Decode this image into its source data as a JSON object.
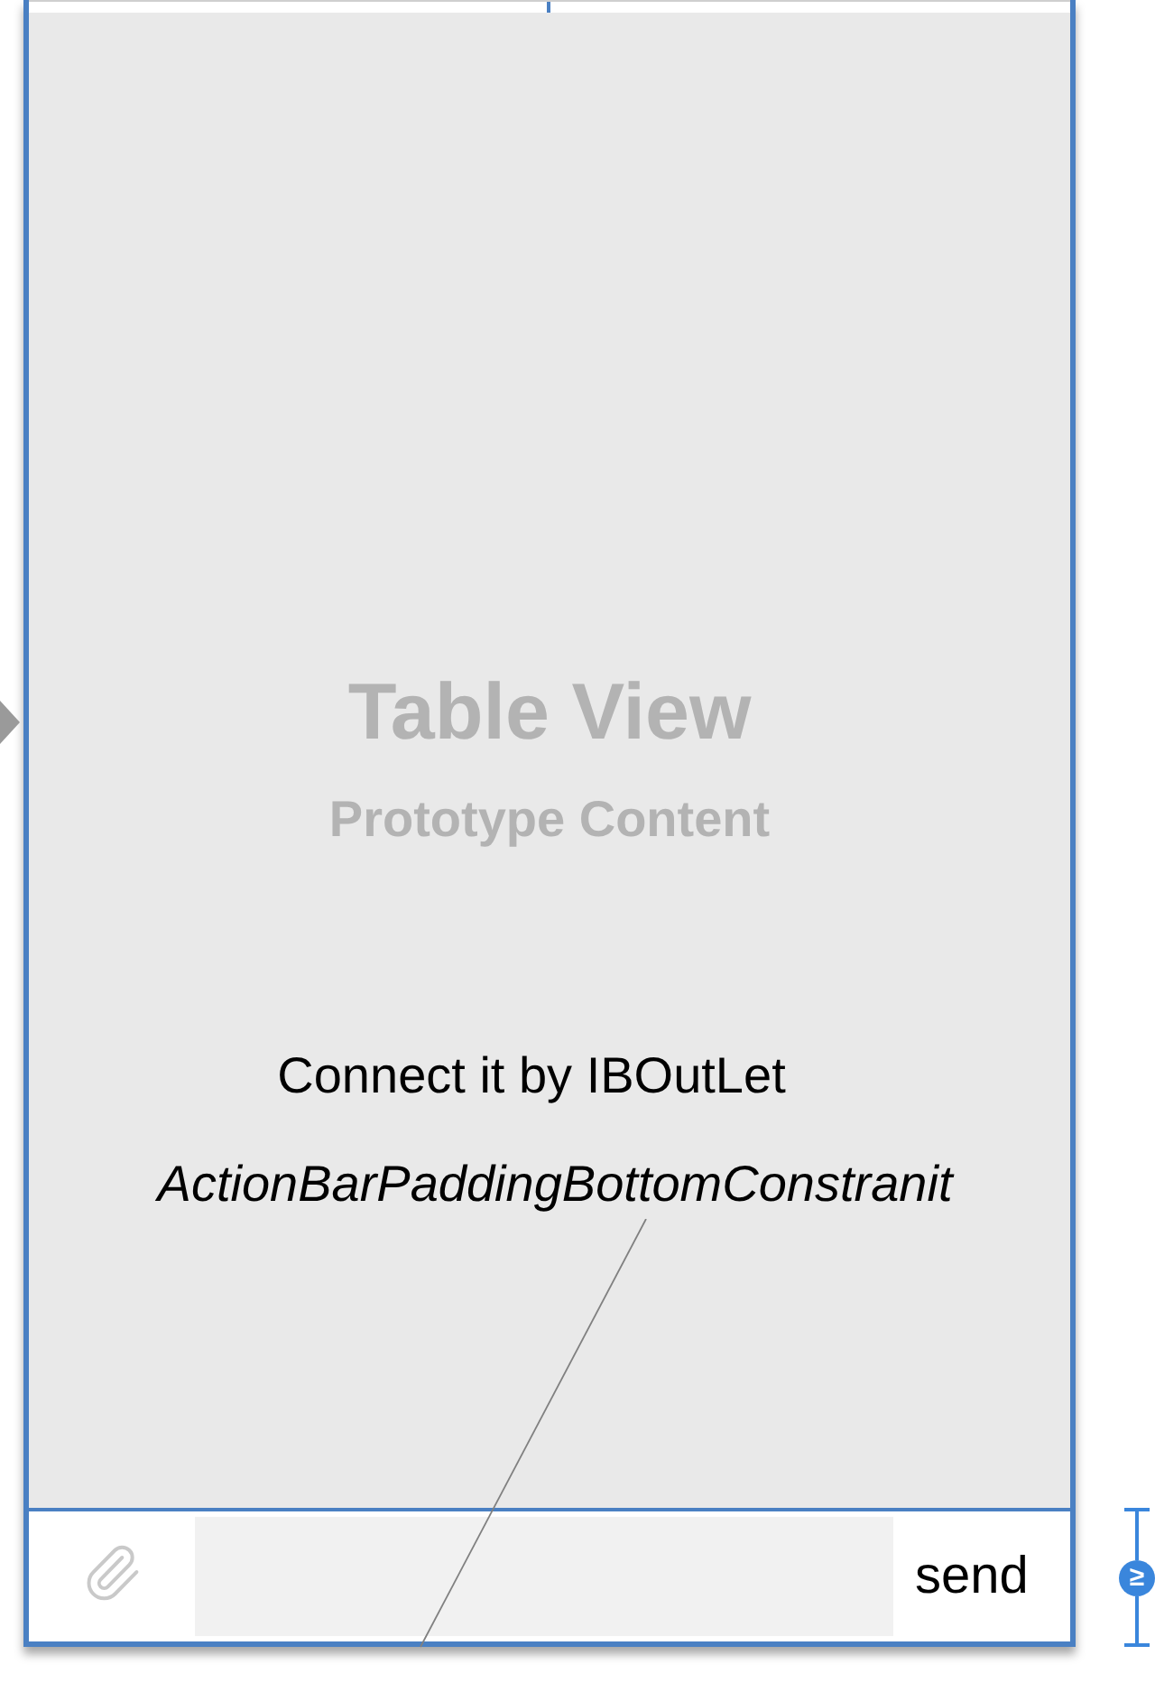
{
  "table_view": {
    "title": "Table View",
    "subtitle": "Prototype Content"
  },
  "annotation": {
    "caption": "Connect it by IBOutLet",
    "constraint_name": "ActionBarPaddingBottomConstranit"
  },
  "action_bar": {
    "send_label": "send"
  },
  "constraint_badge": {
    "symbol": "≥"
  }
}
